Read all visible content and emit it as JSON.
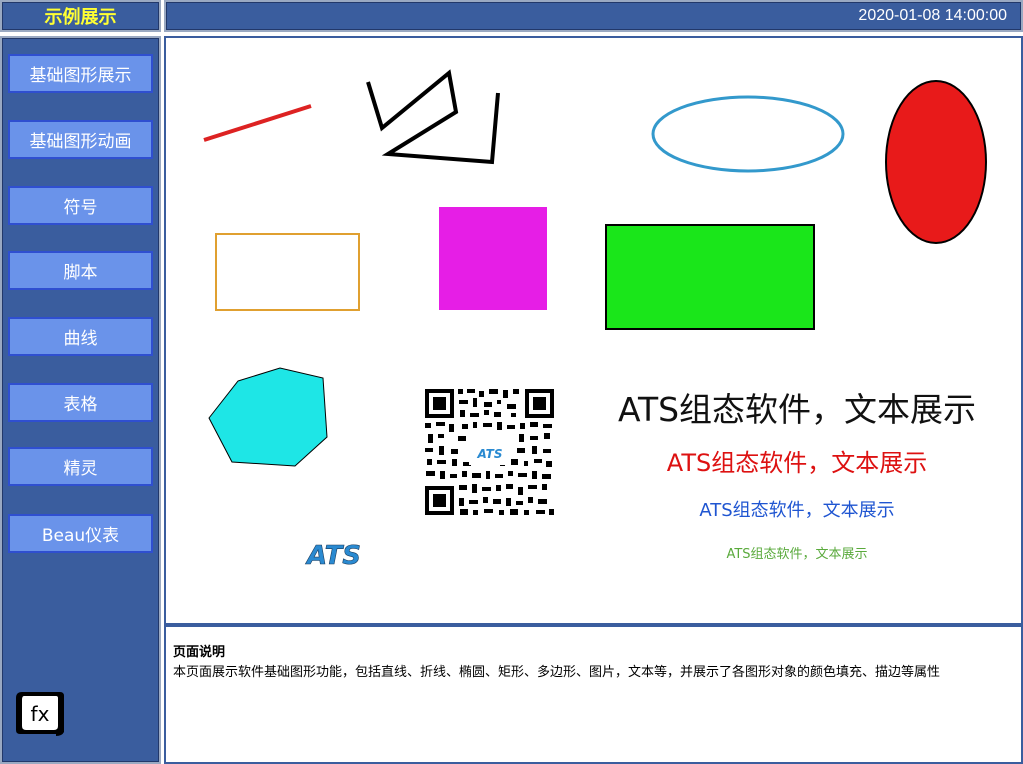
{
  "app": {
    "title": "示例展示"
  },
  "header": {
    "datetime": "2020-01-08 14:00:00"
  },
  "sidebar": {
    "items": [
      {
        "label": "基础图形展示"
      },
      {
        "label": "基础图形动画"
      },
      {
        "label": "符号"
      },
      {
        "label": "脚本"
      },
      {
        "label": "曲线"
      },
      {
        "label": "表格"
      },
      {
        "label": "精灵"
      },
      {
        "label": "Beau仪表"
      }
    ],
    "fx_icon_label": "fx"
  },
  "canvas": {
    "text_samples": [
      "ATS组态软件，文本展示",
      "ATS组态软件，文本展示",
      "ATS组态软件，文本展示",
      "ATS组态软件，文本展示"
    ],
    "logo_text": "ATS",
    "qr_logo_text": "ATS",
    "colors": {
      "line": "#dd2222",
      "polyline": "#000000",
      "ellipse_outline": "#3399cc",
      "ellipse_fill": "#e81a1a",
      "rect_outline": "#e0a030",
      "magenta": "#e61ee6",
      "green": "#1ae61a",
      "hexagon": "#1ee6e6"
    }
  },
  "description": {
    "title": "页面说明",
    "text": "本页面展示软件基础图形功能，包括直线、折线、椭圆、矩形、多边形、图片，文本等，并展示了各图形对象的颜色填充、描边等属性"
  }
}
